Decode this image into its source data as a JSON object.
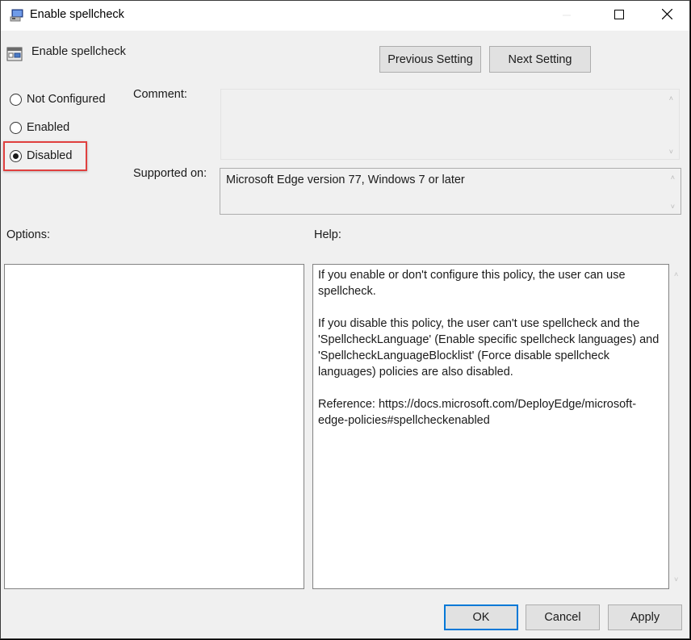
{
  "window": {
    "title": "Enable spellcheck",
    "controls": {
      "minimize": "minimize-icon",
      "maximize": "maximize-icon",
      "close": "close-icon"
    }
  },
  "header": {
    "setting_name": "Enable spellcheck",
    "previous_label": "Previous Setting",
    "next_label": "Next Setting"
  },
  "state": {
    "options": [
      {
        "label": "Not Configured",
        "checked": false
      },
      {
        "label": "Enabled",
        "checked": false
      },
      {
        "label": "Disabled",
        "checked": true
      }
    ],
    "highlight_color": "#e0403f"
  },
  "comment": {
    "label": "Comment:",
    "value": ""
  },
  "supported_on": {
    "label": "Supported on:",
    "value": "Microsoft Edge version 77, Windows 7 or later"
  },
  "options_panel": {
    "label": "Options:"
  },
  "help_panel": {
    "label": "Help:",
    "paragraphs": [
      "If you enable or don't configure this policy, the user can use spellcheck.",
      "If you disable this policy, the user can't use spellcheck and the 'SpellcheckLanguage' (Enable specific spellcheck languages) and 'SpellcheckLanguageBlocklist' (Force disable spellcheck languages) policies are also disabled.",
      "Reference: https://docs.microsoft.com/DeployEdge/microsoft-edge-policies#spellcheckenabled"
    ]
  },
  "footer": {
    "ok_label": "OK",
    "cancel_label": "Cancel",
    "apply_label": "Apply",
    "default_button_color": "#0078d7"
  }
}
